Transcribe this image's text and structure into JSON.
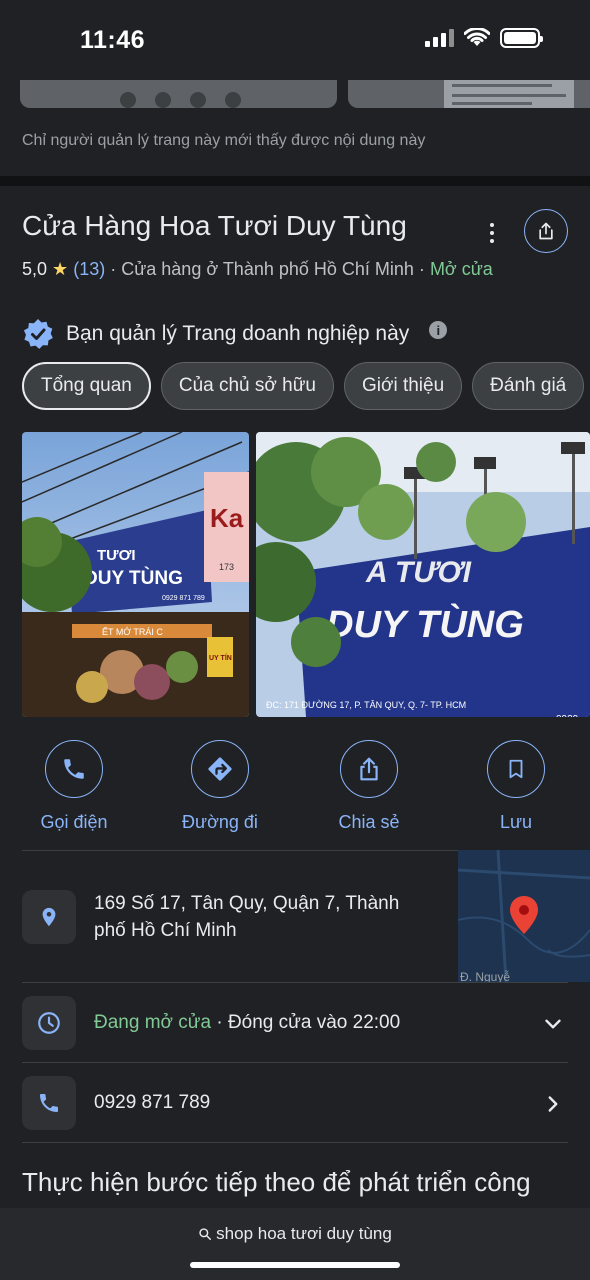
{
  "status_bar": {
    "time": "11:46"
  },
  "owner_note": "Chỉ người quản lý trang này mới thấy được nội dung này",
  "business": {
    "name": "Cửa Hàng Hoa Tươi Duy Tùng",
    "rating": "5,0",
    "review_count": "(13)",
    "category": "· Cửa hàng ở Thành phố Hồ Chí Minh ·",
    "open_status": "Mở cửa",
    "verified_text": "Bạn quản lý Trang doanh nghiệp này",
    "info_glyph": "i"
  },
  "tabs": [
    {
      "label": "Tổng quan",
      "active": true
    },
    {
      "label": "Của chủ sở hữu",
      "active": false
    },
    {
      "label": "Giới thiệu",
      "active": false
    },
    {
      "label": "Đánh giá",
      "active": false
    }
  ],
  "photos": {
    "photo1_sign_line1": "TƯƠI",
    "photo1_sign_line2": "DUY TÙNG",
    "photo1_sign_small": "0929 871 789",
    "photo1_red_sign": "Ka",
    "photo1_red_sign_small": "173",
    "photo1_yellow_sign": "UY TÍN",
    "photo1_banner": "ẾT MỚ TRÁI C",
    "photo2_sign_line1": "A TƯƠI",
    "photo2_sign_line2": "DUY TÙNG",
    "photo2_address": "ĐC: 171 ĐƯỜNG 17, P. TÂN QUY, Q. 7- TP. HCM",
    "photo2_small": "0929"
  },
  "actions": [
    {
      "label": "Gọi điện",
      "icon": "phone-icon"
    },
    {
      "label": "Đường đi",
      "icon": "directions-icon"
    },
    {
      "label": "Chia sẻ",
      "icon": "share-icon"
    },
    {
      "label": "Lưu",
      "icon": "bookmark-icon"
    }
  ],
  "address": {
    "text": "169 Số 17, Tân Quy, Quận 7, Thành phố Hồ Chí Minh",
    "map_label": "Đ. Nguyễ"
  },
  "hours": {
    "open": "Đang mở cửa",
    "rest": " · Đóng cửa vào 22:00"
  },
  "phone": {
    "number": "0929 871 789"
  },
  "next_steps_heading": "Thực hiện bước tiếp theo để phát triển công việc kinh doanh",
  "search": {
    "query": "shop hoa tươi duy tùng"
  },
  "colors": {
    "background": "#202124",
    "accent_blue": "#8ab4f8",
    "open_green": "#81c995",
    "star_yellow": "#fdd663"
  }
}
